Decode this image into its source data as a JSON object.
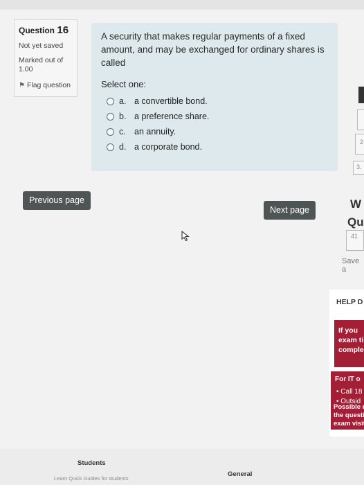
{
  "question_info": {
    "title": "Question",
    "number": "16",
    "status": "Not yet saved",
    "marked_label": "Marked out of",
    "marked_value": "1.00",
    "flag_label": "Flag question"
  },
  "question": {
    "text": "A security that makes regular payments of a fixed amount, and may be exchanged for ordinary shares is called",
    "prompt": "Select one:",
    "options": [
      {
        "letter": "a.",
        "text": "a convertible bond."
      },
      {
        "letter": "b.",
        "text": "a preference share."
      },
      {
        "letter": "c.",
        "text": "an annuity."
      },
      {
        "letter": "d.",
        "text": "a corporate bond."
      }
    ]
  },
  "navigation": {
    "previous_label": "Previous page",
    "next_label": "Next page"
  },
  "side_panel": {
    "box_a": "2",
    "box_b": "3.",
    "title_w": "W",
    "title_q": "Qu",
    "box_c": "41",
    "save_label": "Save a",
    "help_title": "HELP D",
    "help_note_lines": [
      "If you",
      "exam ti",
      "comple"
    ],
    "for_it": "For IT o",
    "bullets": [
      "Call 18",
      "Outsid"
    ],
    "possible_lines": [
      "Possible r",
      "the questi",
      "exam visit"
    ]
  },
  "footer": {
    "students": "Students",
    "quick_guides": "Learn Quick Guides for students",
    "general": "General"
  },
  "colors": {
    "content_bg": "#dde9ec",
    "button_bg": "#4f5554",
    "help_red": "#a31f36"
  }
}
